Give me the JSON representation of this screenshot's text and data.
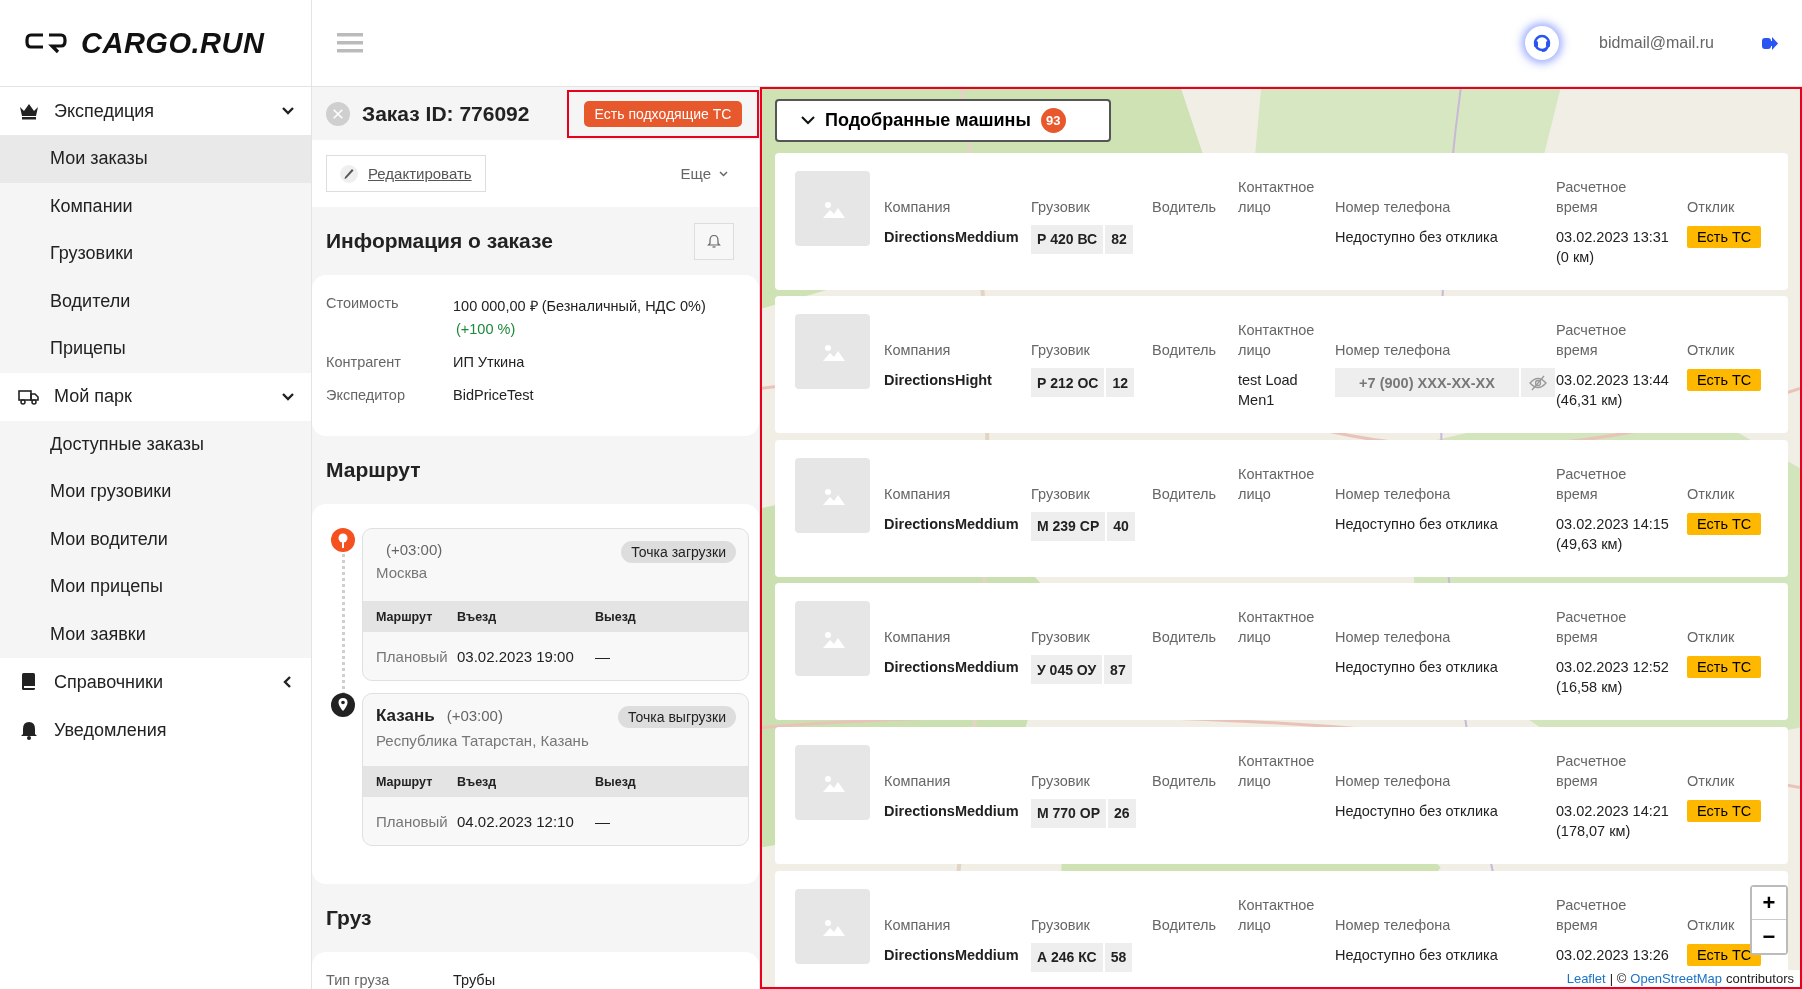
{
  "header": {
    "logo": "CARGO.RUN",
    "user_email": "bidmail@mail.ru"
  },
  "sidebar": {
    "groups": [
      {
        "label": "Экспедиция",
        "expanded": true,
        "children": [
          {
            "label": "Мои заказы",
            "selected": true
          },
          {
            "label": "Компании",
            "selected": false
          },
          {
            "label": "Грузовики",
            "selected": false
          },
          {
            "label": "Водители",
            "selected": false
          },
          {
            "label": "Прицепы",
            "selected": false
          }
        ]
      },
      {
        "label": "Мой парк",
        "expanded": true,
        "children": [
          {
            "label": "Доступные заказы",
            "selected": false
          },
          {
            "label": "Мои грузовики",
            "selected": false
          },
          {
            "label": "Мои водители",
            "selected": false
          },
          {
            "label": "Мои прицепы",
            "selected": false
          },
          {
            "label": "Мои заявки",
            "selected": false
          }
        ]
      },
      {
        "label": "Справочники",
        "expanded": false
      },
      {
        "label": "Уведомления"
      }
    ]
  },
  "order": {
    "title": "Заказ ID: 776092",
    "status_badge": "Есть подходящие ТС",
    "edit_button": "Редактировать",
    "more_menu": "Еще",
    "info": {
      "title": "Информация о заказе",
      "fields": [
        {
          "label": "Стоимость",
          "value": "100 000,00 ₽ (Безналичный, НДС 0%)",
          "note": "(+100 %)"
        },
        {
          "label": "Контрагент",
          "value": "ИП Уткина"
        },
        {
          "label": "Экспедитор",
          "value": "BidPriceTest"
        }
      ]
    },
    "route": {
      "title": "Маршрут",
      "points": [
        {
          "kind": "loading",
          "timezone": "(+03:00)",
          "address": "Москва",
          "tag": "Точка загрузки",
          "columns": [
            "Маршрут",
            "Въезд",
            "Выезд"
          ],
          "row": [
            "Плановый",
            "03.02.2023 19:00",
            "—"
          ]
        },
        {
          "kind": "unloading",
          "city": "Казань",
          "timezone": "(+03:00)",
          "address": "Республика Татарстан, Казань",
          "tag": "Точка выгрузки",
          "columns": [
            "Маршрут",
            "Въезд",
            "Выезд"
          ],
          "row": [
            "Плановый",
            "04.02.2023 12:10",
            "—"
          ]
        }
      ]
    },
    "cargo": {
      "title": "Груз",
      "fields": [
        {
          "label": "Тип груза",
          "value": "Трубы"
        }
      ]
    }
  },
  "matches": {
    "title": "Подобранные машины",
    "count": "93",
    "expanded": true,
    "cards": [
      {
        "labels": [
          "Компания",
          "Грузовик",
          "Водитель",
          "Контактное лицо",
          "Номер телефона",
          "Расчетное время",
          "Отклик"
        ],
        "company": "DirectionsMeddium",
        "plate": "Р 420 ВС",
        "region": "82",
        "phone": {
          "kind": "unavailable",
          "text": "Недоступно без отклика"
        },
        "time": "03.02.2023 13:31",
        "distance": "(0 км)",
        "response": "Есть ТС"
      },
      {
        "labels": [
          "Компания",
          "Грузовик",
          "Водитель",
          "Контактное лицо",
          "Номер телефона",
          "Расчетное время",
          "Отклик"
        ],
        "company": "DirectionsHight",
        "plate": "Р 212 ОС",
        "region": "12",
        "contact": "test Load Men1",
        "phone": {
          "kind": "masked",
          "text": "+7 (900) XXX-XX-XX"
        },
        "time": "03.02.2023 13:44",
        "distance": "(46,31 км)",
        "response": "Есть ТС"
      },
      {
        "labels": [
          "Компания",
          "Грузовик",
          "Водитель",
          "Контактное лицо",
          "Номер телефона",
          "Расчетное время",
          "Отклик"
        ],
        "company": "DirectionsMeddium",
        "plate": "М 239 СР",
        "region": "40",
        "phone": {
          "kind": "unavailable",
          "text": "Недоступно без отклика"
        },
        "time": "03.02.2023 14:15",
        "distance": "(49,63 км)",
        "response": "Есть ТС"
      },
      {
        "labels": [
          "Компания",
          "Грузовик",
          "Водитель",
          "Контактное лицо",
          "Номер телефона",
          "Расчетное время",
          "Отклик"
        ],
        "company": "DirectionsMeddium",
        "plate": "У 045 ОУ",
        "region": "87",
        "phone": {
          "kind": "unavailable",
          "text": "Недоступно без отклика"
        },
        "time": "03.02.2023 12:52",
        "distance": "(16,58 км)",
        "response": "Есть ТС"
      },
      {
        "labels": [
          "Компания",
          "Грузовик",
          "Водитель",
          "Контактное лицо",
          "Номер телефона",
          "Расчетное время",
          "Отклик"
        ],
        "company": "DirectionsMeddium",
        "plate": "М 770 ОР",
        "region": "26",
        "phone": {
          "kind": "unavailable",
          "text": "Недоступно без отклика"
        },
        "time": "03.02.2023 14:21",
        "distance": "(178,07 км)",
        "response": "Есть ТС"
      },
      {
        "labels": [
          "Компания",
          "Грузовик",
          "Водитель",
          "Контактное лицо",
          "Номер телефона",
          "Расчетное время",
          "Отклик"
        ],
        "company": "DirectionsMeddium",
        "plate": "А 246 КС",
        "region": "58",
        "phone": {
          "kind": "unavailable",
          "text": "Недоступно без отклика"
        },
        "time": "03.02.2023 13:26",
        "response": "Есть ТС"
      }
    ]
  },
  "map": {
    "zoom_in": "+",
    "zoom_out": "−",
    "attribution": {
      "link1": "Leaflet",
      "separator": "| ©",
      "link2": "OpenStreetMap",
      "suffix": "contributors"
    }
  }
}
